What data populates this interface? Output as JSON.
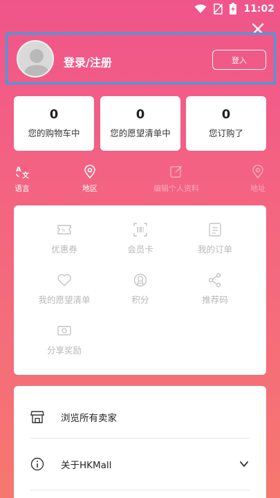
{
  "status_bar": {
    "time": "11:02",
    "icons": [
      "wifi-icon",
      "no-sim-icon",
      "battery-charging-icon"
    ]
  },
  "profile": {
    "title": "登录/注册",
    "login_button": "登入"
  },
  "stats": [
    {
      "value": "0",
      "label": "您的购物车中"
    },
    {
      "value": "0",
      "label": "您的愿望清单中"
    },
    {
      "value": "0",
      "label": "您订购了"
    }
  ],
  "quick_links": [
    {
      "label": "语言",
      "icon": "translate-icon",
      "enabled": true
    },
    {
      "label": "地区",
      "icon": "location-pin-icon",
      "enabled": true
    },
    {
      "label": "编辑个人资料",
      "icon": "edit-icon",
      "enabled": false
    },
    {
      "label": "地址",
      "icon": "location-pin-icon",
      "enabled": false
    }
  ],
  "grid_menu": [
    {
      "label": "优惠券",
      "icon": "coupon-icon"
    },
    {
      "label": "会员卡",
      "icon": "barcode-icon"
    },
    {
      "label": "我的订单",
      "icon": "order-list-icon"
    },
    {
      "label": "我的愿望清单",
      "icon": "heart-icon"
    },
    {
      "label": "积分",
      "icon": "points-badge-icon"
    },
    {
      "label": "推荐码",
      "icon": "share-icon"
    },
    {
      "label": "分享奖励",
      "icon": "money-icon"
    }
  ],
  "list_menu": [
    {
      "label": "浏览所有卖家",
      "icon": "store-icon"
    },
    {
      "label": "关于HKMall",
      "icon": "info-icon",
      "trailing_icon": "chevron-down-icon"
    }
  ],
  "colors": {
    "gradient_top": "#f0558a",
    "gradient_bottom": "#f6776f",
    "highlight_border": "#3b9fe4",
    "disabled_text": "#b8b8b8"
  }
}
